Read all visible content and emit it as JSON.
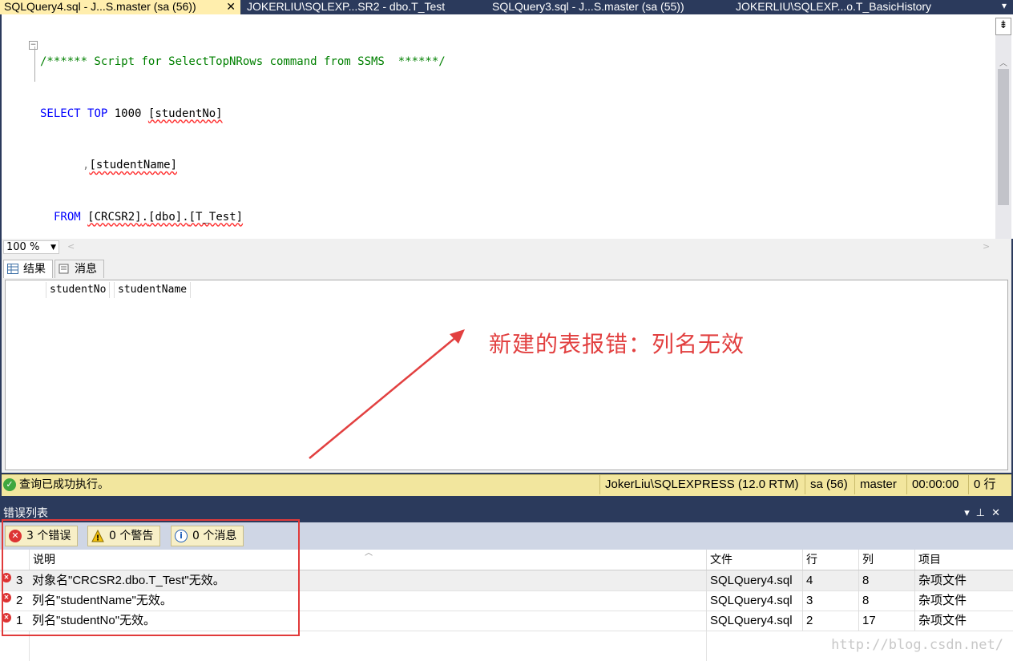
{
  "tabs": [
    {
      "label": "SQLQuery4.sql - J...S.master (sa (56))",
      "active": true
    },
    {
      "label": "JOKERLIU\\SQLEXP...SR2 - dbo.T_Test",
      "active": false
    },
    {
      "label": "SQLQuery3.sql - J...S.master (sa (55))",
      "active": false
    },
    {
      "label": "JOKERLIU\\SQLEXP...o.T_BasicHistory",
      "active": false
    }
  ],
  "editor": {
    "line1": "/****** Script for SelectTopNRows command from SSMS  ******/",
    "line2_kw1": "SELECT",
    "line2_kw2": "TOP",
    "line2_rest": " 1000 ",
    "line2_col": "[studentNo]",
    "line3_comma": ",",
    "line3_col": "[studentName]",
    "line4_kw": "FROM",
    "line4_a": "[CRCSR2]",
    "line4_b": "[dbo]",
    "line4_c": "[T_Test]",
    "dot": "."
  },
  "zoom": "100 %",
  "results_tabs": {
    "results": "结果",
    "messages": "消息"
  },
  "grid_columns": [
    "studentNo",
    "studentName"
  ],
  "annotation": "新建的表报错：列名无效",
  "status": {
    "message": "查询已成功执行。",
    "server": "JokerLiu\\SQLEXPRESS (12.0 RTM)",
    "user": "sa (56)",
    "db": "master",
    "time": "00:00:00",
    "rows": "0 行"
  },
  "error_panel": {
    "title": "错误列表",
    "errors_btn": "3 个错误",
    "warnings_btn": "0 个警告",
    "messages_btn": "0 个消息",
    "columns": {
      "desc": "说明",
      "file": "文件",
      "line": "行",
      "col": "列",
      "project": "项目"
    },
    "rows": [
      {
        "num": "3",
        "desc": "对象名\"CRCSR2.dbo.T_Test\"无效。",
        "file": "SQLQuery4.sql",
        "line": "4",
        "col": "8",
        "project": "杂项文件"
      },
      {
        "num": "2",
        "desc": "列名\"studentName\"无效。",
        "file": "SQLQuery4.sql",
        "line": "3",
        "col": "8",
        "project": "杂项文件"
      },
      {
        "num": "1",
        "desc": "列名\"studentNo\"无效。",
        "file": "SQLQuery4.sql",
        "line": "2",
        "col": "17",
        "project": "杂项文件"
      }
    ]
  },
  "watermark": "http://blog.csdn.net/",
  "colors": {
    "accent_tab": "#ffeead",
    "frame": "#2b3a5c",
    "status": "#f2e69e",
    "annotation": "#e24040"
  }
}
